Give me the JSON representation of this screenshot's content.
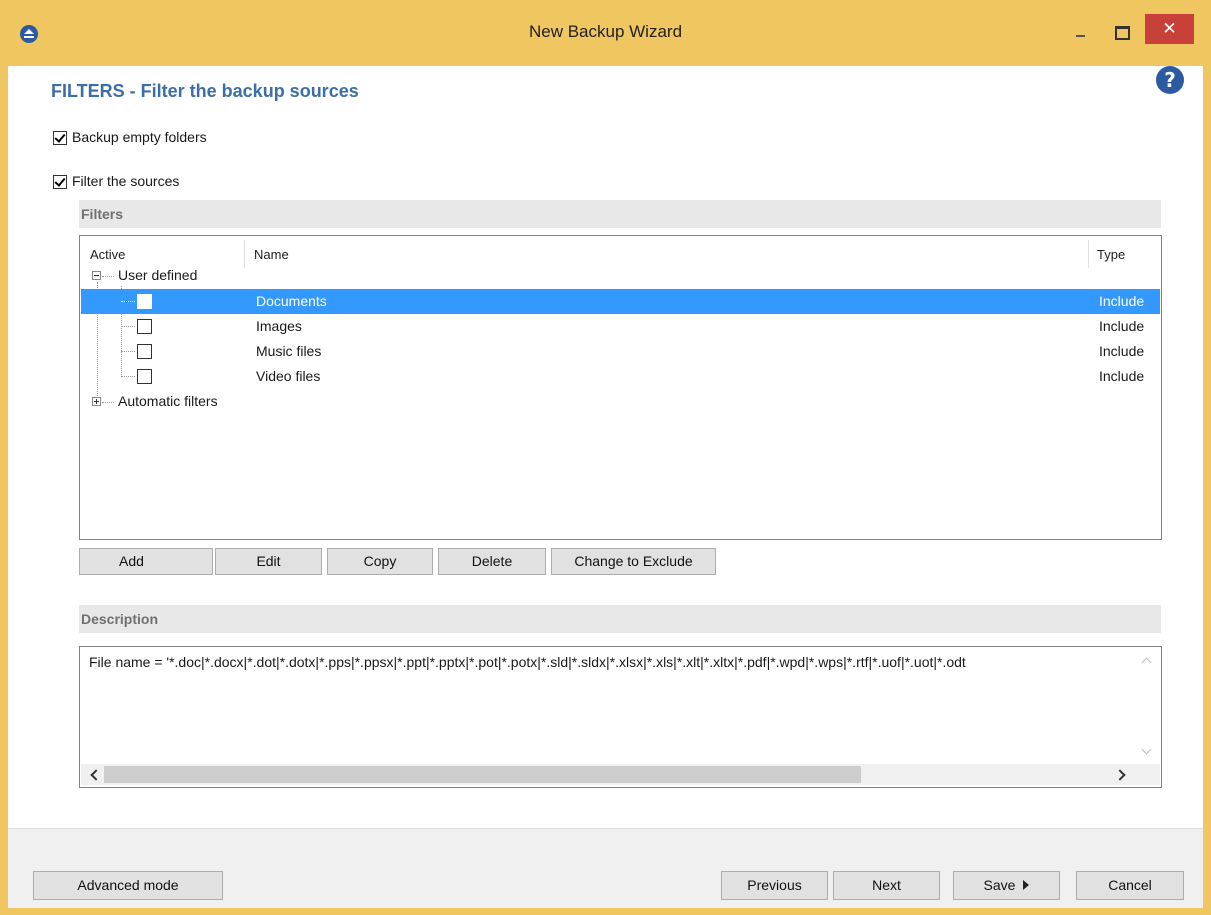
{
  "window": {
    "title": "New Backup Wizard",
    "close_glyph": "✕"
  },
  "page": {
    "title": "FILTERS - Filter the backup sources",
    "help_glyph": "?"
  },
  "options": {
    "backup_empty_folders": {
      "label": "Backup empty folders",
      "checked": true
    },
    "filter_sources": {
      "label": "Filter the sources",
      "checked": true
    }
  },
  "filters": {
    "section_title": "Filters",
    "columns": {
      "active": "Active",
      "name": "Name",
      "type": "Type"
    },
    "groups": [
      {
        "label": "User defined",
        "expanded": true
      },
      {
        "label": "Automatic filters",
        "expanded": false
      }
    ],
    "rows": [
      {
        "name": "Documents",
        "type": "Include",
        "active": false,
        "selected": true
      },
      {
        "name": "Images",
        "type": "Include",
        "active": false,
        "selected": false
      },
      {
        "name": "Music files",
        "type": "Include",
        "active": false,
        "selected": false
      },
      {
        "name": "Video files",
        "type": "Include",
        "active": false,
        "selected": false
      }
    ],
    "buttons": {
      "add": "Add",
      "edit": "Edit",
      "copy": "Copy",
      "delete": "Delete",
      "change": "Change to Exclude"
    }
  },
  "description": {
    "section_title": "Description",
    "text": "File name = '*.doc|*.docx|*.dot|*.dotx|*.pps|*.ppsx|*.ppt|*.pptx|*.pot|*.potx|*.sld|*.sldx|*.xlsx|*.xls|*.xlt|*.xltx|*.pdf|*.wpd|*.wps|*.rtf|*.uof|*.uot|*.odt"
  },
  "footer": {
    "advanced_mode": "Advanced mode",
    "previous": "Previous",
    "next": "Next",
    "save": "Save",
    "cancel": "Cancel"
  },
  "colors": {
    "window_frame": "#f0c660",
    "title_accent": "#3c6ea7",
    "selection": "#3399ff",
    "close_button": "#c7413a"
  },
  "icons": [
    "app-icon",
    "minimize-icon",
    "maximize-icon",
    "close-icon",
    "help-icon",
    "dropdown-arrow-icon",
    "save-arrow-icon"
  ]
}
